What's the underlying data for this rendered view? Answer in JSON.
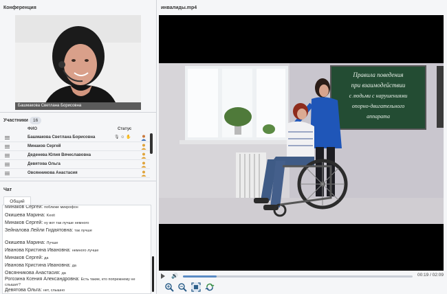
{
  "conference": {
    "title": "Конференция",
    "speaker_name": "Башмакова Светлана Борисовна"
  },
  "participants": {
    "title": "Участники",
    "count": "16",
    "col_fio": "ФИО",
    "col_status": "Статус",
    "rows": [
      {
        "name": "Башмакова Светлана Борисовна",
        "status_icons": "🎙 ☺ ✋"
      },
      {
        "name": "Минаков Сергей",
        "status_icons": ""
      },
      {
        "name": "Деденева Юлия Вячеславовна",
        "status_icons": ""
      },
      {
        "name": "Девятова Ольга",
        "status_icons": ""
      },
      {
        "name": "Овсянникова Анастасия",
        "status_icons": ""
      }
    ]
  },
  "chat": {
    "title": "Чат",
    "tab_label": "Общий",
    "messages": [
      {
        "author": "Минаков Сергей:",
        "text": "поближе микрофон"
      },
      {
        "author": "Окишева Марина:",
        "text": "Kexit"
      },
      {
        "author": "Минаков Сергей:",
        "text": "ну вот так лучше немного"
      },
      {
        "author": "Зейналова Лейли Гидаятовна:",
        "text": "так лучше"
      },
      {
        "author": "Окишева Марина:",
        "text": "Лучше"
      },
      {
        "author": "Иванова Кристина Ивановна:",
        "text": "немного лучше"
      },
      {
        "author": "Минаков Сергей:",
        "text": "да"
      },
      {
        "author": "Иванова Кристина Ивановна:",
        "text": "да"
      },
      {
        "author": "Овсянникова Анастасия:",
        "text": "да"
      },
      {
        "author": "Рогозина Ксения Александровна:",
        "text": "Есть такие, кто попрежнему не слышит?"
      },
      {
        "author": "Девятова Ольга:",
        "text": "нет, слышно"
      }
    ]
  },
  "player": {
    "title": "инвалиды.mp4",
    "time": "00:19 / 02:09",
    "progress": 0.147,
    "board_text": [
      "Правила поведения",
      "при взаимодействии",
      "с людьми с нарушениями",
      "опорно-двигательного",
      "аппарата"
    ]
  },
  "colors": {
    "accent": "#5a8bc4",
    "panel_bg": "#f5f6f8",
    "board_green": "#234c33"
  }
}
